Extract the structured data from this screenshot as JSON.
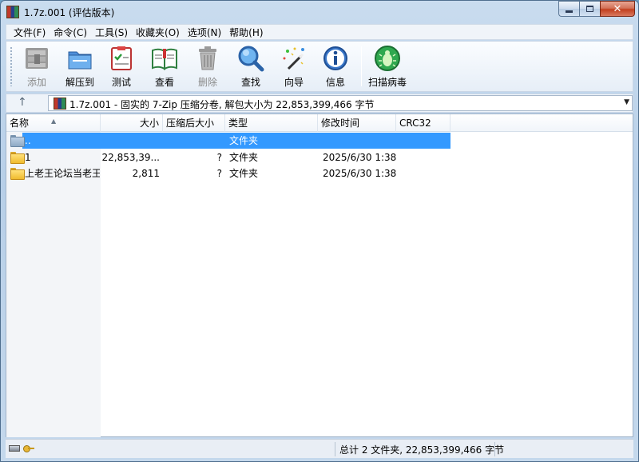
{
  "window": {
    "title": "1.7z.001 (评估版本)"
  },
  "menu": [
    "文件(F)",
    "命令(C)",
    "工具(S)",
    "收藏夹(O)",
    "选项(N)",
    "帮助(H)"
  ],
  "toolbar": {
    "add": "添加",
    "extract_to": "解压到",
    "test": "测试",
    "view": "查看",
    "delete": "删除",
    "find": "查找",
    "wizard": "向导",
    "info": "信息",
    "virus_scan": "扫描病毒"
  },
  "address": {
    "path": "1.7z.001 - 固实的 7-Zip 压缩分卷, 解包大小为 22,853,399,466 字节"
  },
  "columns": {
    "name": "名称",
    "size": "大小",
    "packed": "压缩后大小",
    "type": "类型",
    "modified": "修改时间",
    "crc": "CRC32"
  },
  "rows": [
    {
      "name": "..",
      "size": "",
      "packed": "",
      "type": "文件夹",
      "modified": "",
      "crc": ""
    },
    {
      "name": "1",
      "size": "22,853,39...",
      "packed": "?",
      "type": "文件夹",
      "modified": "2025/6/30 1:38",
      "crc": ""
    },
    {
      "name": "上老王论坛当老王",
      "size": "2,811",
      "packed": "?",
      "type": "文件夹",
      "modified": "2025/6/30 1:38",
      "crc": ""
    }
  ],
  "status": {
    "summary": "总计 2 文件夹, 22,853,399,466 字节"
  },
  "colors": {
    "selection": "#3399ff",
    "close_button": "#c2401f"
  }
}
